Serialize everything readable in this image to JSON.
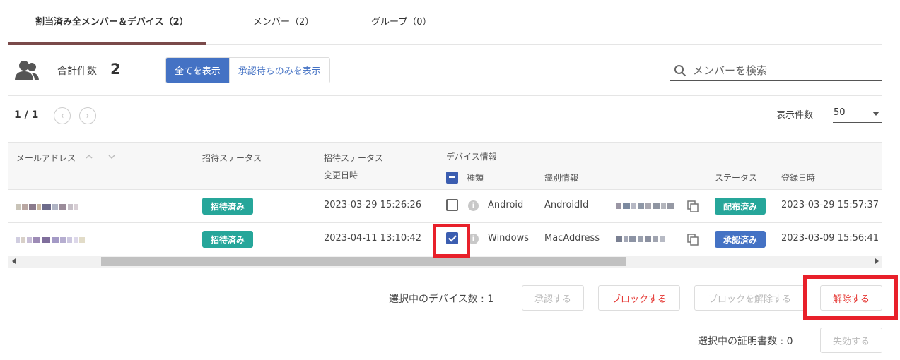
{
  "tabs": [
    {
      "label": "割当済み全メンバー＆デバイス（2）",
      "active": true
    },
    {
      "label": "メンバー（2）",
      "active": false
    },
    {
      "label": "グループ（0）",
      "active": false
    }
  ],
  "summary": {
    "label": "合計件数",
    "count": "2"
  },
  "filters": {
    "all": "全てを表示",
    "pending": "承認待ちのみを表示"
  },
  "search": {
    "placeholder": "メンバーを検索"
  },
  "pager": {
    "text": "1 / 1",
    "prev": "‹",
    "next": "›"
  },
  "per_page": {
    "label": "表示件数",
    "value": "50"
  },
  "table": {
    "headers": {
      "email": "メールアドレス",
      "invite_status": "招待ステータス",
      "invite_changed_1": "招待ステータス",
      "invite_changed_2": "変更日時",
      "device_info": "デバイス情報",
      "type": "種類",
      "identifier": "識別情報",
      "status": "ステータス",
      "registered": "登録日時"
    },
    "rows": [
      {
        "invite_status": "招待済み",
        "changed_at": "2023-03-29 15:26:26",
        "checked": false,
        "type": "Android",
        "identifier": "AndroidId",
        "status": "配布済み",
        "status_color": "#26a69a",
        "registered": "2023-03-29 15:57:37"
      },
      {
        "invite_status": "招待済み",
        "changed_at": "2023-04-11 13:10:42",
        "checked": true,
        "type": "Windows",
        "identifier": "MacAddress",
        "status": "承認済み",
        "status_color": "#4472c4",
        "registered": "2023-03-09 15:56:41"
      }
    ]
  },
  "actions": {
    "selected_devices": "選択中のデバイス数 : 1",
    "approve": "承認する",
    "block": "ブロックする",
    "unblock": "ブロックを解除する",
    "release": "解除する",
    "selected_certs": "選択中の証明書数 : 0",
    "revoke": "失効する"
  },
  "colors": {
    "accent": "#4472c4",
    "tab_underline": "#7a4a4a",
    "badge_green": "#26a69a",
    "highlight": "#e8202a",
    "danger": "#e53935"
  }
}
